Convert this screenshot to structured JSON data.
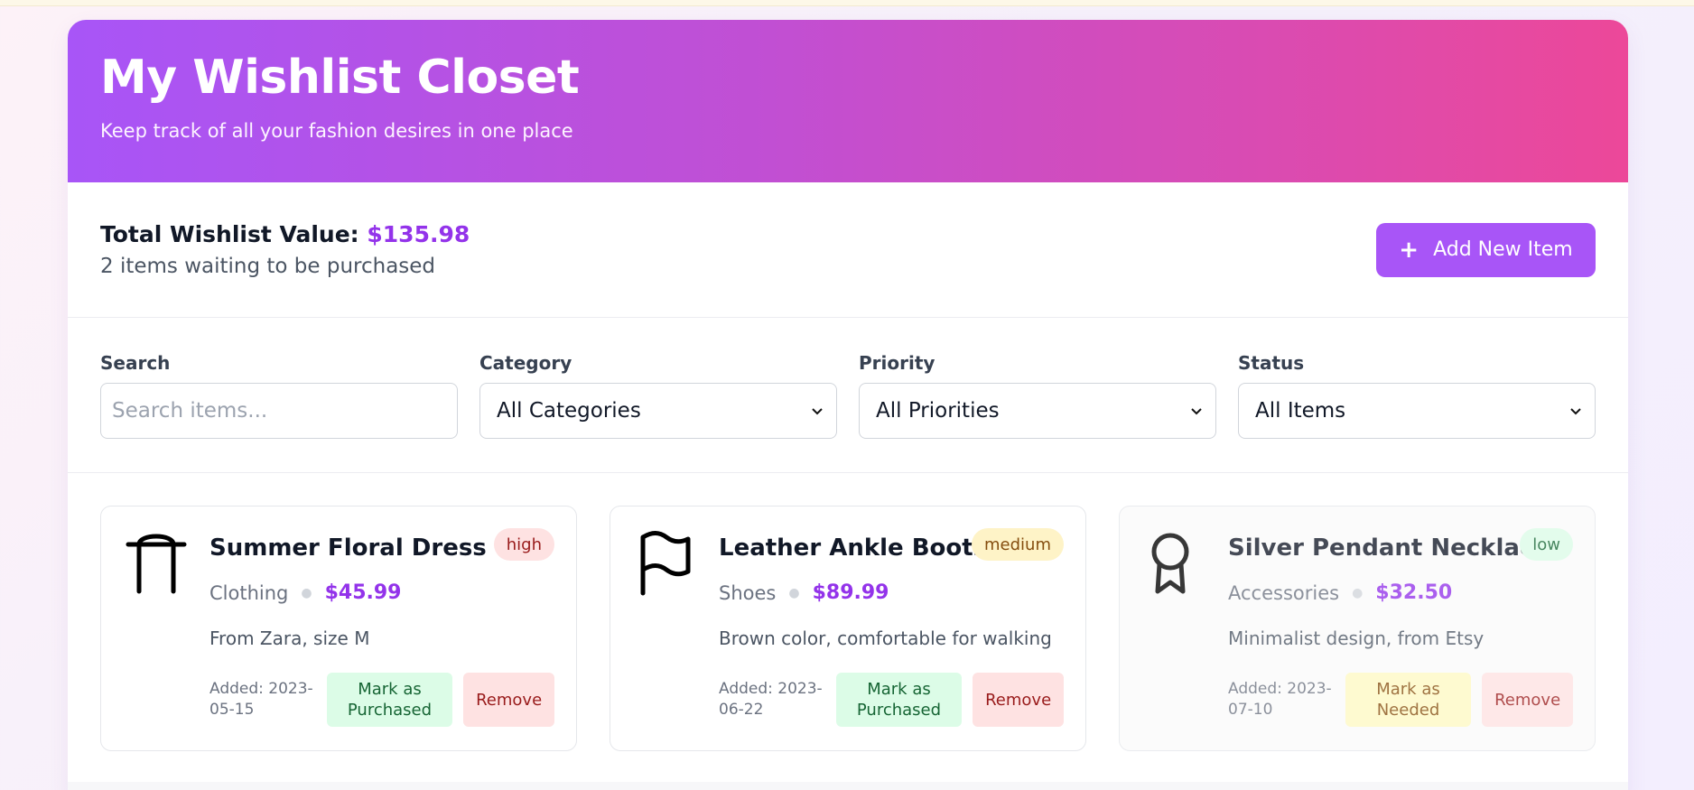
{
  "header": {
    "title": "My Wishlist Closet",
    "subtitle": "Keep track of all your fashion desires in one place"
  },
  "summary": {
    "total_label": "Total Wishlist Value:",
    "total_value": "$135.98",
    "count_text": "2 items waiting to be purchased",
    "add_button_icon": "+",
    "add_button_label": "Add New Item"
  },
  "filters": {
    "search": {
      "label": "Search",
      "placeholder": "Search items..."
    },
    "category": {
      "label": "Category",
      "selected": "All Categories"
    },
    "priority": {
      "label": "Priority",
      "selected": "All Priorities"
    },
    "status": {
      "label": "Status",
      "selected": "All Items"
    }
  },
  "items": [
    {
      "icon": "shirt-icon",
      "title": "Summer Floral Dress",
      "priority": "high",
      "category": "Clothing",
      "price": "$45.99",
      "note": "From Zara, size M",
      "added": "Added: 2023-05-15",
      "action_label": "Mark as Purchased",
      "remove_label": "Remove"
    },
    {
      "icon": "flag-icon",
      "title": "Leather Ankle Boots",
      "priority": "medium",
      "category": "Shoes",
      "price": "$89.99",
      "note": "Brown color, comfortable for walking",
      "added": "Added: 2023-06-22",
      "action_label": "Mark as Purchased",
      "remove_label": "Remove"
    },
    {
      "icon": "award-icon",
      "title": "Silver Pendant Necklace",
      "priority": "low",
      "category": "Accessories",
      "price": "$32.50",
      "note": "Minimalist design, from Etsy",
      "added": "Added: 2023-07-10",
      "action_label": "Mark as Needed",
      "remove_label": "Remove"
    }
  ],
  "colors": {
    "accent": "#a855f7",
    "gradient_start": "#a855f7",
    "gradient_end": "#ec4899",
    "price": "#9333ea"
  }
}
